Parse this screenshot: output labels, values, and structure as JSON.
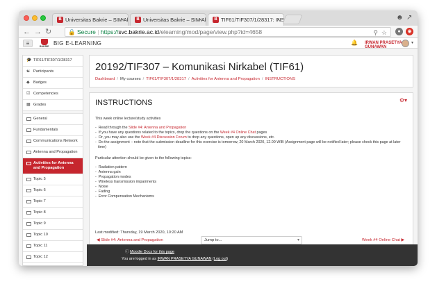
{
  "browser": {
    "tabs": [
      {
        "title": "Universitas Bakrie – SIM Akad",
        "active": false
      },
      {
        "title": "Universitas Bakrie – SIM Akad",
        "active": false
      },
      {
        "title": "TIF61/TIF307/1/28317: INST",
        "active": true
      }
    ],
    "address": {
      "secure_label": "Secure",
      "url_prefix": "https://",
      "url_host": "svc.bakrie.ac.id",
      "url_path": "/elearning/mod/page/view.php?id=4658"
    }
  },
  "navbar": {
    "brand": "BIG E-LEARNING",
    "logo_text": "BAKRIE",
    "user_name": "IRWAN PRASETYA GUNAWAN"
  },
  "sidebar": {
    "items": [
      {
        "label": "TIF61/TIF307/1/28317",
        "icon": "graduation-cap-icon"
      },
      {
        "label": "Participants",
        "icon": "users-icon"
      },
      {
        "label": "Badges",
        "icon": "shield-icon"
      },
      {
        "label": "Competencies",
        "icon": "check-square-icon"
      },
      {
        "label": "Grades",
        "icon": "table-icon"
      }
    ],
    "sections": [
      {
        "label": "General",
        "active": false
      },
      {
        "label": "Fundamentals",
        "active": false
      },
      {
        "label": "Communications Network",
        "active": false
      },
      {
        "label": "Antenna and Propagation",
        "active": false
      },
      {
        "label": "Activities for Antenna and Propagation",
        "active": true
      },
      {
        "label": "Topic 5",
        "active": false
      },
      {
        "label": "Topic 6",
        "active": false
      },
      {
        "label": "Topic 7",
        "active": false
      },
      {
        "label": "Topic 8",
        "active": false
      },
      {
        "label": "Topic 9",
        "active": false
      },
      {
        "label": "Topic 10",
        "active": false
      },
      {
        "label": "Topic 11",
        "active": false
      },
      {
        "label": "Topic 12",
        "active": false
      }
    ]
  },
  "header": {
    "title": "20192/TIF307 – Komunikasi Nirkabel (TIF61)",
    "breadcrumbs": [
      {
        "label": "Dashboard",
        "link": true
      },
      {
        "label": "My courses",
        "link": false
      },
      {
        "label": "TIF61/TIF307/1/28317",
        "link": true
      },
      {
        "label": "Activities for Antenna and Propagation",
        "link": true
      },
      {
        "label": "INSTRUCTIONS",
        "link": true
      }
    ]
  },
  "page": {
    "title": "INSTRUCTIONS",
    "intro": "This week online lecture/study activities",
    "steps": {
      "s1_pre": "Read through the ",
      "s1_link": "Slide #4: Antenna and Propagation",
      "s2_pre": "If you have any questions related to the topics, drop the questions on the ",
      "s2_link": "Week #4 Online Chat",
      "s2_post": " pages",
      "s3_pre": "Or, you may also use the ",
      "s3_link": "Week #4 Discussion Forum",
      "s3_post": " to drop any questions, open up any discussions, etc.",
      "s4": "Do the assignment – note that the submission deadline for this exercise is tomorrow, 20 March 2020, 12.00 WIB (Assignment page will be notified later; please check this page at later time)"
    },
    "attention": "Particular attention should be given to the following topics:",
    "topics": [
      "Radiation pattern",
      "Antenna gain",
      "Propagation modes",
      "Wireless transmission impairments",
      "Noise",
      "Fading",
      "Error Compensation Mechanisms"
    ],
    "last_modified": "Last modified: Thursday, 19 March 2020, 10:20 AM",
    "prev_link": "Slide #4: Antenna and Propagation",
    "jump_placeholder": "Jump to...",
    "next_link": "Week #4 Online Chat"
  },
  "footer": {
    "docs_link": "Moodle Docs for this page",
    "logged_in_pre": "You are logged in as ",
    "logged_in_user": "IRWAN PRASETYA GUNAWAN",
    "logout": "Log out"
  },
  "colors": {
    "accent": "#c6262e",
    "footer_bg": "#333333"
  }
}
